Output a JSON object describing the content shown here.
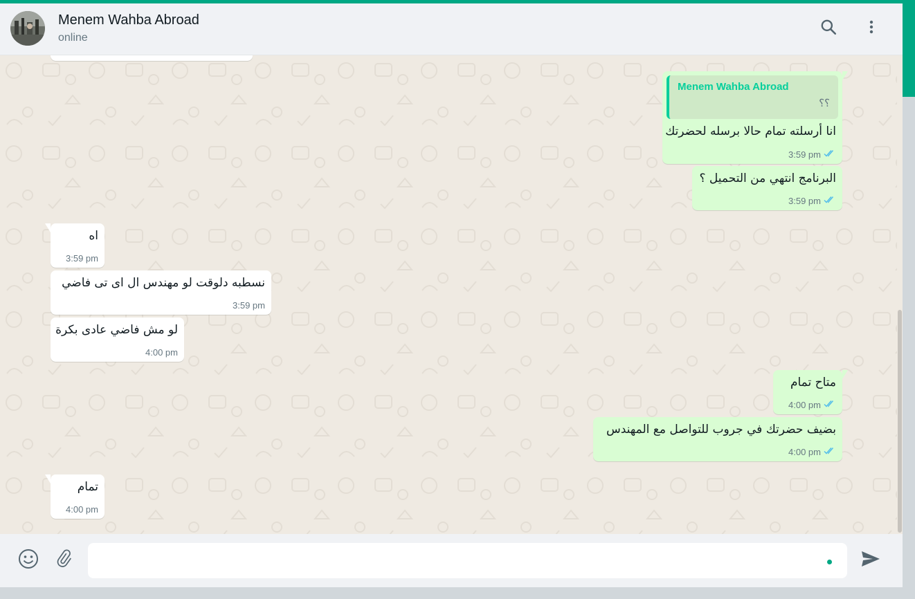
{
  "colors": {
    "accent": "#00a884",
    "outgoing_bubble": "#d9fdd3",
    "incoming_bubble": "#ffffff",
    "chat_background": "#efeae2",
    "read_ticks": "#53bdeb"
  },
  "header": {
    "contact_name": "Menem Wahba Abroad",
    "status": "online",
    "icons": [
      "search-icon",
      "menu-icon"
    ]
  },
  "messages": [
    {
      "direction": "out",
      "quote": {
        "author": "Menem Wahba Abroad",
        "text": "؟؟"
      },
      "text": "انا أرسلته تمام حالا برسله لحضرتك",
      "time": "3:59 pm",
      "status": "read"
    },
    {
      "direction": "out",
      "text": "البرنامج انتهي من التحميل ؟",
      "time": "3:59 pm",
      "status": "read"
    },
    {
      "direction": "in",
      "text": "اه",
      "time": "3:59 pm"
    },
    {
      "direction": "in",
      "text": "نسطبه دلوقت لو مهندس ال اى تى فاضي",
      "time": "3:59 pm"
    },
    {
      "direction": "in",
      "text": "لو مش فاضي عادى بكرة",
      "time": "4:00 pm"
    },
    {
      "direction": "out",
      "text": "متاح تمام",
      "time": "4:00 pm",
      "status": "read"
    },
    {
      "direction": "out",
      "text": "بضيف حضرتك في جروب للتواصل مع المهندس",
      "time": "4:00 pm",
      "status": "read"
    },
    {
      "direction": "in",
      "text": "تمام",
      "time": "4:00 pm"
    }
  ],
  "composer": {
    "value": "",
    "icons": [
      "emoji-icon",
      "attach-icon",
      "send-icon"
    ]
  }
}
